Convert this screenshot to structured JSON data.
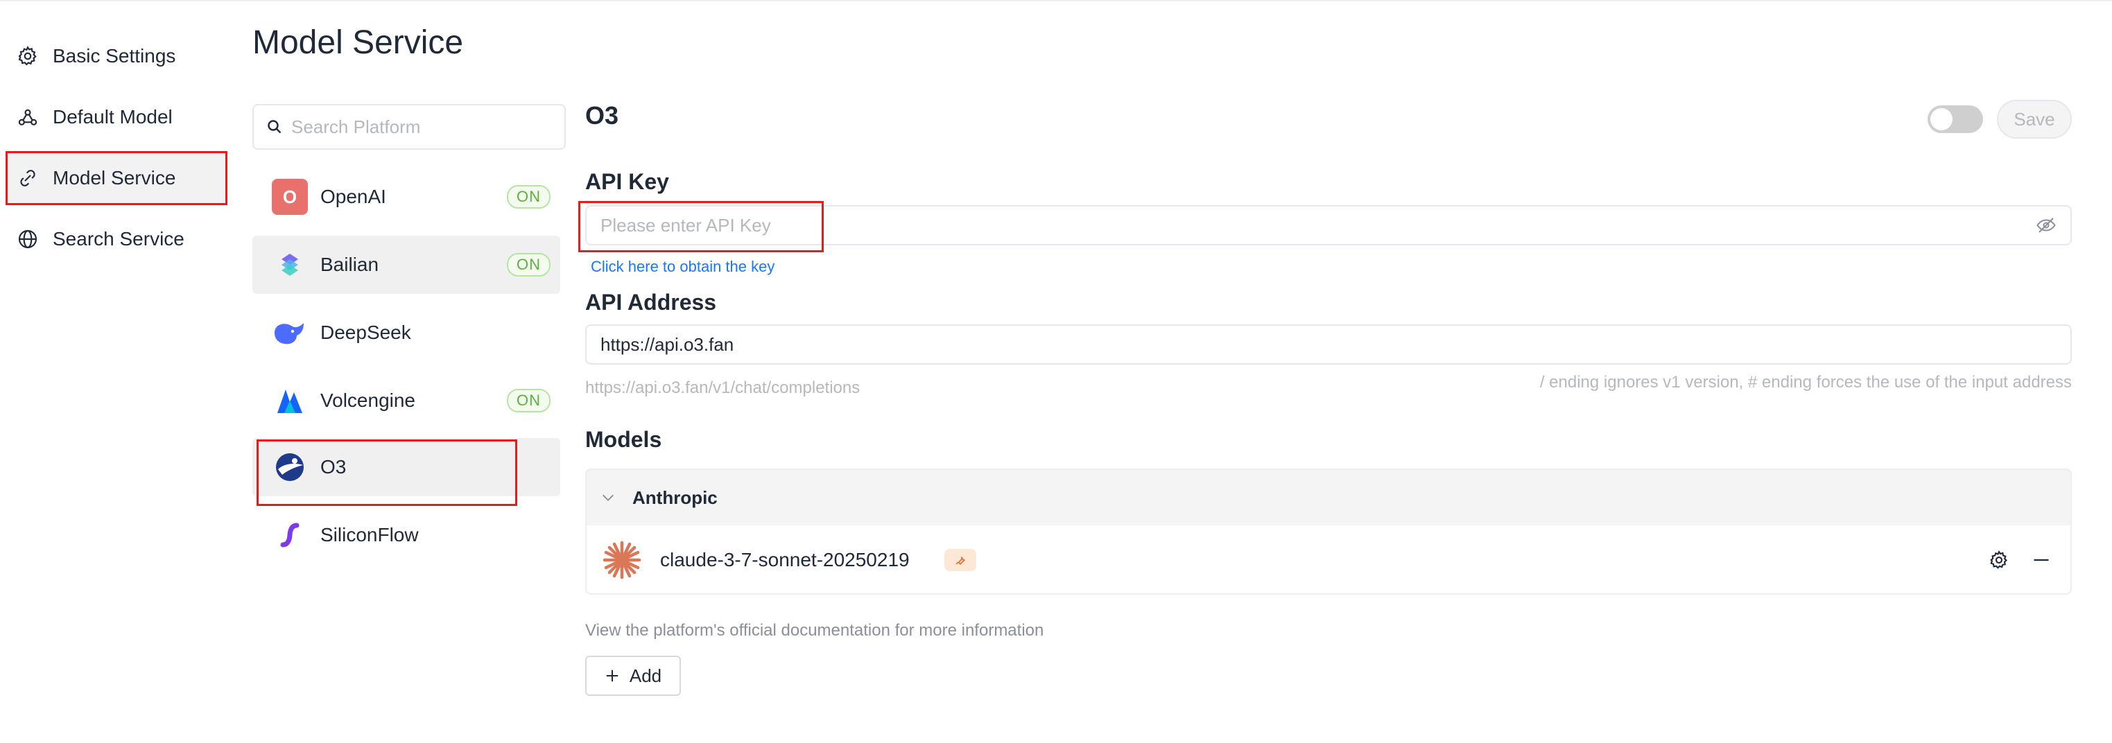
{
  "nav": {
    "items": [
      {
        "label": "Basic Settings",
        "icon": "gear-icon"
      },
      {
        "label": "Default Model",
        "icon": "model-nodes-icon"
      },
      {
        "label": "Model Service",
        "icon": "link-icon"
      },
      {
        "label": "Search Service",
        "icon": "globe-icon"
      }
    ],
    "active": "Model Service"
  },
  "page": {
    "title": "Model Service"
  },
  "search": {
    "placeholder": "Search Platform"
  },
  "providers": [
    {
      "name": "OpenAI",
      "badge": "ON",
      "logo_letter": "O",
      "logo_color": "#e8716e"
    },
    {
      "name": "Bailian",
      "badge": "ON"
    },
    {
      "name": "DeepSeek",
      "badge": ""
    },
    {
      "name": "Volcengine",
      "badge": "ON"
    },
    {
      "name": "O3",
      "badge": ""
    },
    {
      "name": "SiliconFlow",
      "badge": ""
    }
  ],
  "selected_provider": "O3",
  "detail": {
    "title": "O3",
    "enabled": false,
    "save_label": "Save",
    "api_key": {
      "label": "API Key",
      "placeholder": "Please enter API Key",
      "value": "",
      "link": "Click here to obtain the key"
    },
    "api_address": {
      "label": "API Address",
      "value": "https://api.o3.fan",
      "preview": "https://api.o3.fan/v1/chat/completions",
      "hint": "/ ending ignores v1 version, # ending forces the use of the input address"
    },
    "models": {
      "label": "Models",
      "groups": [
        {
          "name": "Anthropic",
          "expanded": true,
          "models": [
            {
              "name": "claude-3-7-sonnet-20250219",
              "tag": "tool-use"
            }
          ]
        }
      ]
    },
    "doc_note": "View the platform's official documentation for more information",
    "add_label": "Add"
  },
  "colors": {
    "accent_link": "#1677ff",
    "on_badge": "#5ab23b",
    "highlight": "#e11d1d"
  }
}
